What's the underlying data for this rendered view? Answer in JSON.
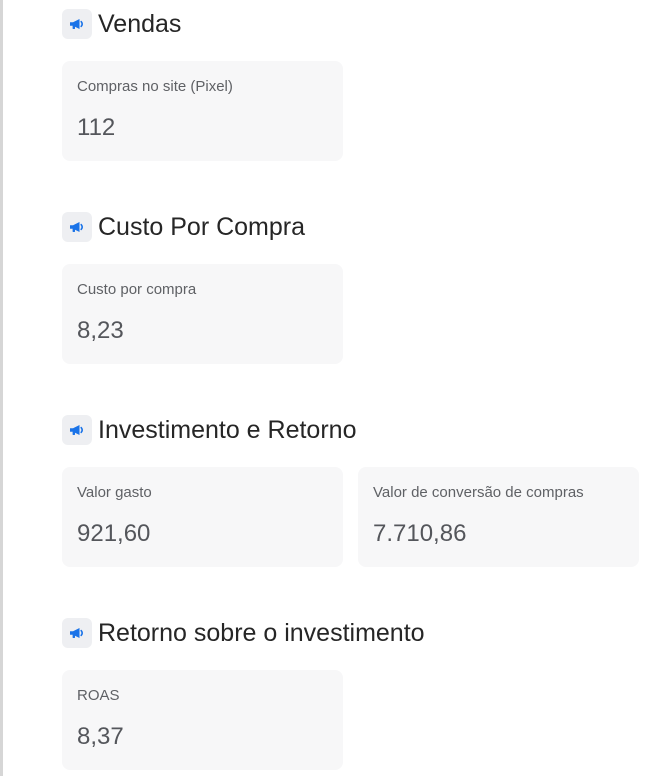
{
  "colors": {
    "icon_accent": "#1a73e8",
    "icon_background": "#eeeff2",
    "card_background": "#f7f7f8",
    "title_text": "#262626",
    "label_text": "#5f6165",
    "value_text": "#54565b"
  },
  "sections": [
    {
      "icon": "megaphone-icon",
      "title": "Vendas",
      "cards": [
        {
          "label": "Compras no site (Pixel)",
          "value": "112"
        }
      ]
    },
    {
      "icon": "megaphone-icon",
      "title": "Custo Por Compra",
      "cards": [
        {
          "label": "Custo por compra",
          "value": "8,23"
        }
      ]
    },
    {
      "icon": "megaphone-icon",
      "title": "Investimento e Retorno",
      "cards": [
        {
          "label": "Valor gasto",
          "value": "921,60"
        },
        {
          "label": "Valor de conversão de compras",
          "value": "7.710,86"
        }
      ]
    },
    {
      "icon": "megaphone-icon",
      "title": "Retorno sobre o investimento",
      "cards": [
        {
          "label": "ROAS",
          "value": "8,37"
        }
      ]
    }
  ]
}
